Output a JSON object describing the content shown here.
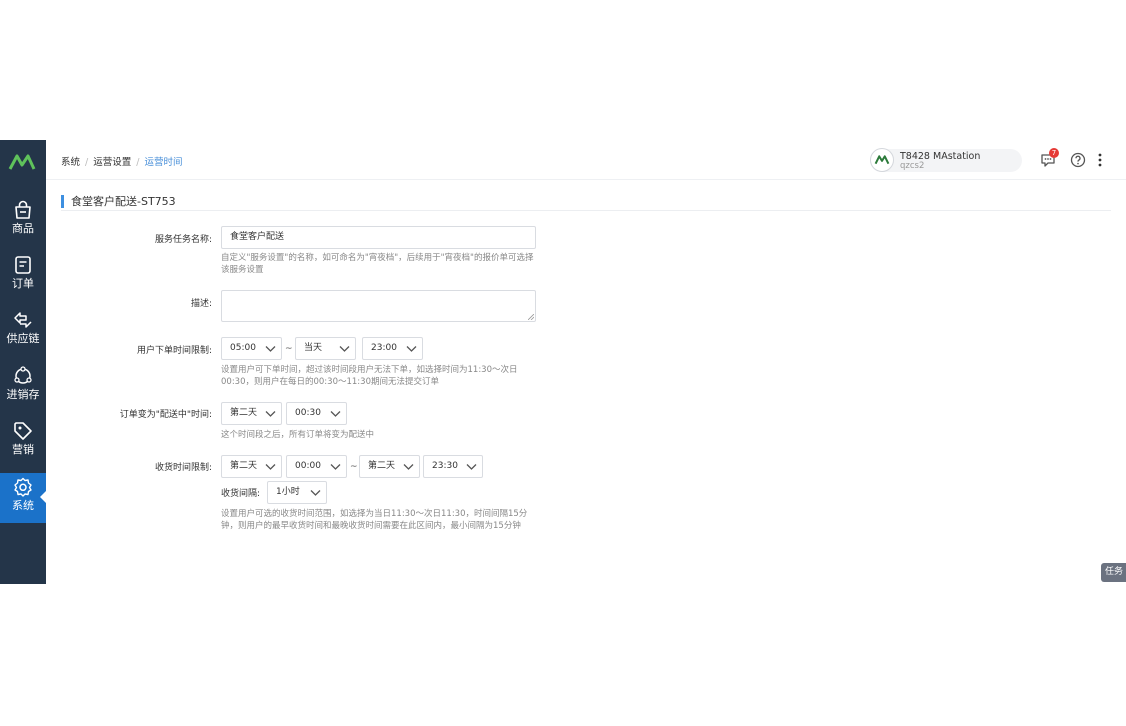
{
  "sidebar": {
    "items": [
      {
        "label": "商品"
      },
      {
        "label": "订单"
      },
      {
        "label": "供应链"
      },
      {
        "label": "进销存"
      },
      {
        "label": "营销"
      },
      {
        "label": "系统"
      }
    ],
    "active_index": 5
  },
  "breadcrumb": [
    "系统",
    "运营设置",
    "运营时间"
  ],
  "store": {
    "name": "T8428 MAstation",
    "code": "qzcs2"
  },
  "notifications": {
    "count": "7"
  },
  "section": {
    "title": "食堂客户配送-ST753"
  },
  "form": {
    "service_name": {
      "label": "服务任务名称:",
      "value": "食堂客户配送",
      "hint": "自定义\"服务设置\"的名称，如可命名为\"宵夜档\"，后续用于\"宵夜档\"的报价单可选择该服务设置"
    },
    "description": {
      "label": "描述:",
      "value": ""
    },
    "order_time_limit": {
      "label": "用户下单时间限制:",
      "start": "05:00",
      "separator": "~",
      "day": "当天",
      "end": "23:00",
      "hint": "设置用户可下单时间，超过该时间段用户无法下单，如选择时间为11:30～次日00:30，则用户在每日的00:30～11:30期间无法提交订单"
    },
    "delivery_status_time": {
      "label": "订单变为\"配送中\"时间:",
      "day": "第二天",
      "time": "00:30",
      "hint": "这个时间段之后，所有订单将变为配送中"
    },
    "receive_time_limit": {
      "label": "收货时间限制:",
      "start_day": "第二天",
      "start_time": "00:00",
      "separator": "~",
      "end_day": "第二天",
      "end_time": "23:30",
      "interval_label": "收货间隔:",
      "interval": "1小时",
      "hint": "设置用户可选的收货时间范围，如选择为当日11:30～次日11:30，时间间隔15分钟，则用户的最早收货时间和最晚收货时间需要在此区间内，最小间隔为15分钟"
    }
  },
  "task_button": {
    "label": "任务"
  },
  "colors": {
    "sidebar": "#243549",
    "active": "#1b72c9",
    "accent": "#3d8fe0",
    "badge": "#e53935"
  }
}
